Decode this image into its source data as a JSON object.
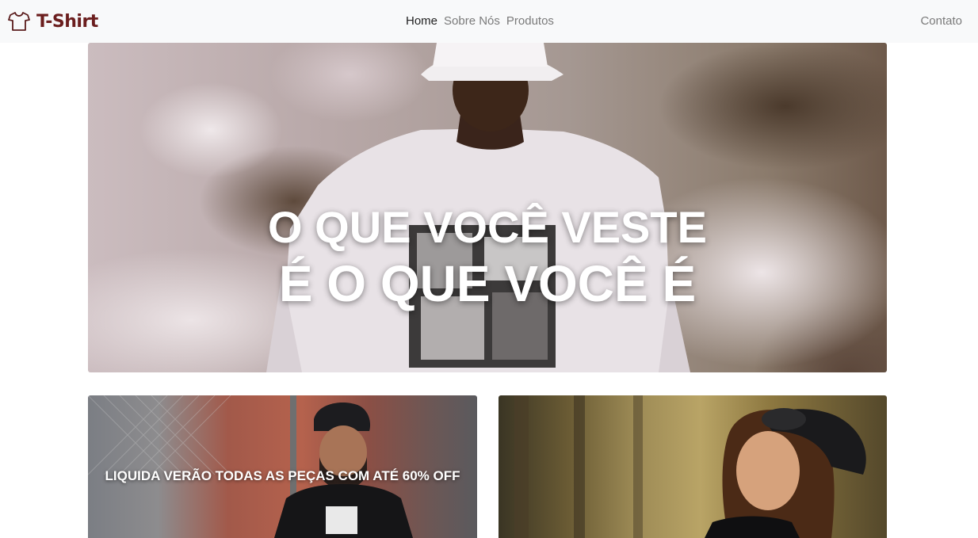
{
  "brand": {
    "name": "T-Shirt",
    "icon": "tshirt-icon",
    "color": "#6b1e1e"
  },
  "nav": {
    "items": [
      {
        "label": "Home",
        "active": true
      },
      {
        "label": "Sobre Nós",
        "active": false
      },
      {
        "label": "Produtos",
        "active": false
      }
    ],
    "contact": "Contato"
  },
  "hero": {
    "line1": "O QUE VOCÊ VESTE",
    "line2": "É O QUE VOCÊ É"
  },
  "cards": [
    {
      "caption": "LIQUIDA VERÃO TODAS AS PEÇAS COM ATÉ 60% OFF"
    },
    {
      "caption": ""
    }
  ]
}
